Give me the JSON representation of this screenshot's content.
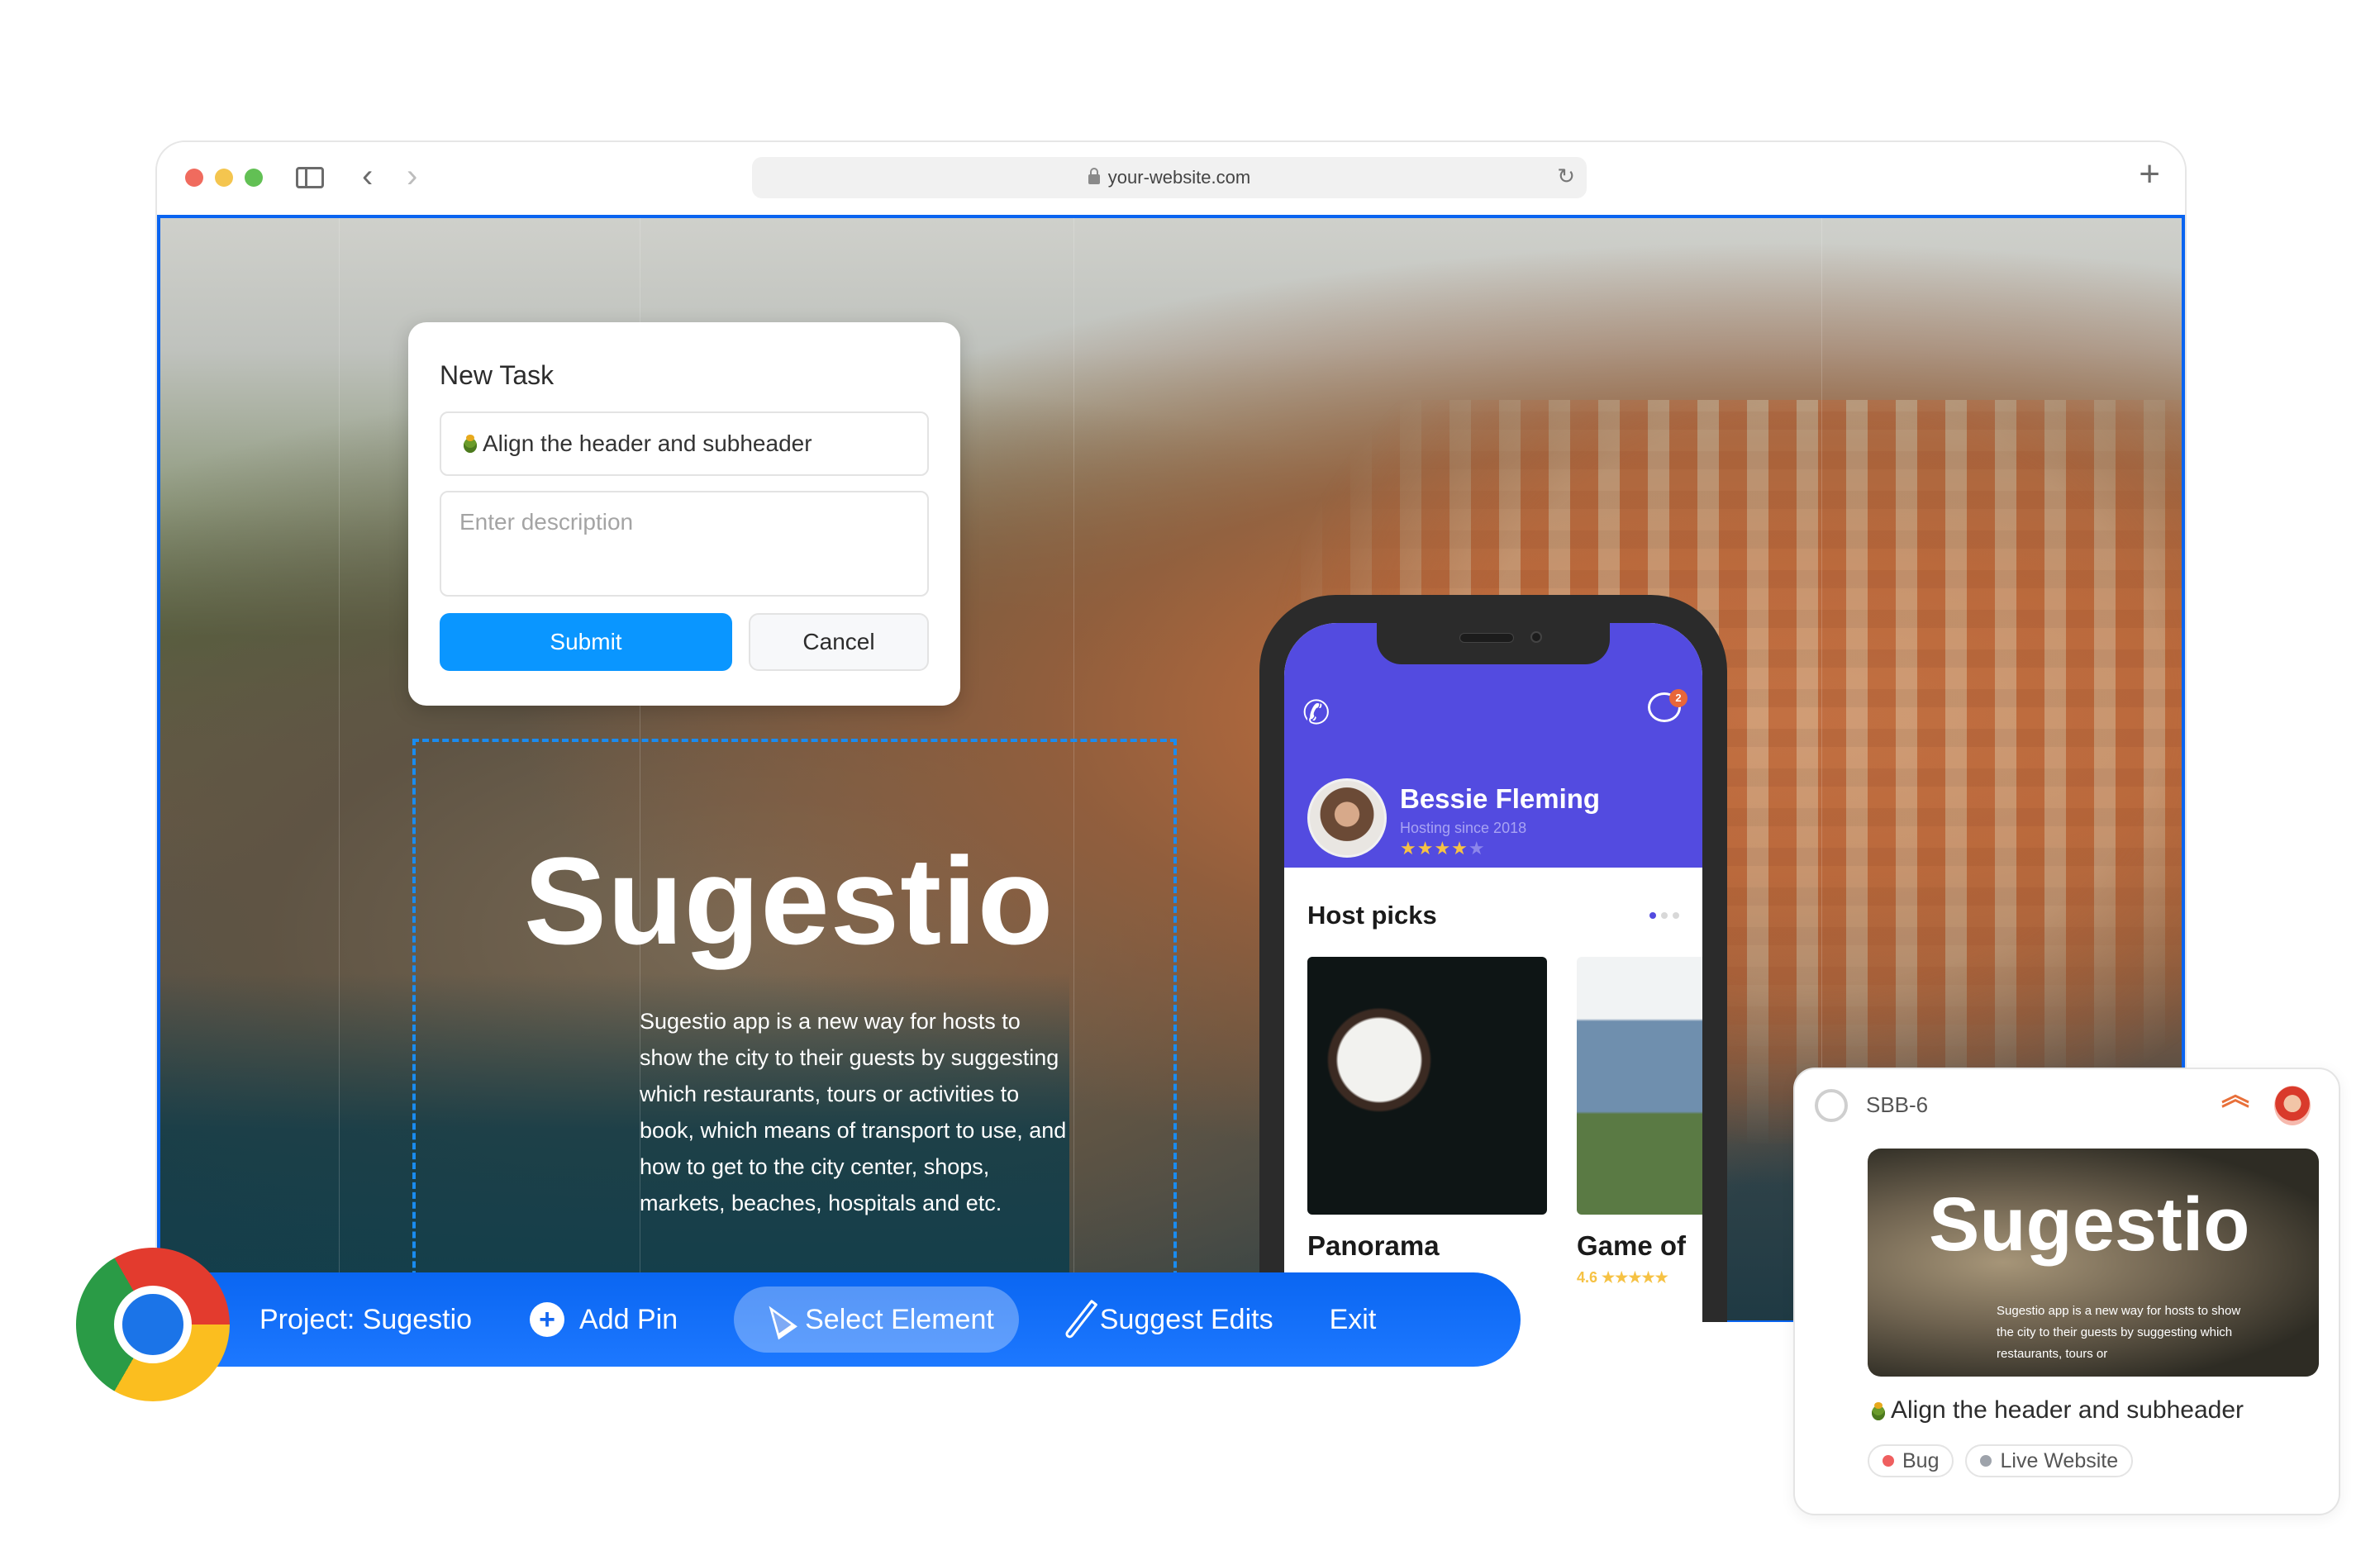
{
  "browser": {
    "url": "your-website.com",
    "icons": {
      "sidebar": "sidebar-toggle-icon",
      "back": "chevron-left-icon",
      "forward": "chevron-right-icon",
      "lock": "lock-icon",
      "reload": "reload-icon",
      "new_tab": "plus-icon"
    },
    "glyphs": {
      "back": "‹",
      "forward": "›",
      "reload": "↻",
      "new_tab": "+"
    }
  },
  "hero": {
    "title": "Sugestio",
    "description": "Sugestio app is a new way for hosts to show the city to their guests by suggesting which restaurants, tours or activities to book, which means of transport to use, and how to get to the city center, shops, markets, beaches, hospitals and etc."
  },
  "new_task": {
    "title": "New Task",
    "name_value": "Align the header and subheader",
    "description_placeholder": "Enter description",
    "submit_label": "Submit",
    "cancel_label": "Cancel"
  },
  "phone_app": {
    "host_name": "Bessie Fleming",
    "host_since": "Hosting since 2018",
    "host_rating_stars": 4,
    "host_rating_max": 5,
    "message_badge": "2",
    "phone_glyph": "✆",
    "section_title": "Host picks",
    "carousel_pages": 3,
    "carousel_active": 1,
    "picks": [
      {
        "title": "Panorama"
      },
      {
        "title": "Game of",
        "rating": "4.6",
        "stars": "★★★★★"
      }
    ],
    "stars_on": "★★★★",
    "stars_off": "★"
  },
  "extension_bar": {
    "project_label": "Project: Sugestio",
    "add_pin_label": "Add Pin",
    "select_element_label": "Select Element",
    "suggest_edits_label": "Suggest Edits",
    "exit_label": "Exit",
    "plus_glyph": "+",
    "active_tool": "Select Element",
    "accent_color": "#0a66f2"
  },
  "task_card": {
    "id": "SBB-6",
    "priority": "high",
    "priority_glyph": "︽",
    "title": "Align the header and subheader",
    "thumbnail": {
      "title": "Sugestio",
      "description": "Sugestio app is a new way for hosts to show the city to their guests by suggesting which restaurants, tours or"
    },
    "tags": [
      {
        "label": "Bug",
        "color": "#ef5f5f"
      },
      {
        "label": "Live Website",
        "color": "#9ea3ab"
      }
    ]
  },
  "colors": {
    "selection": "#1a8cf0",
    "submit": "#0a96ff",
    "phone_header": "#534be0",
    "priority": "#e8703a"
  }
}
